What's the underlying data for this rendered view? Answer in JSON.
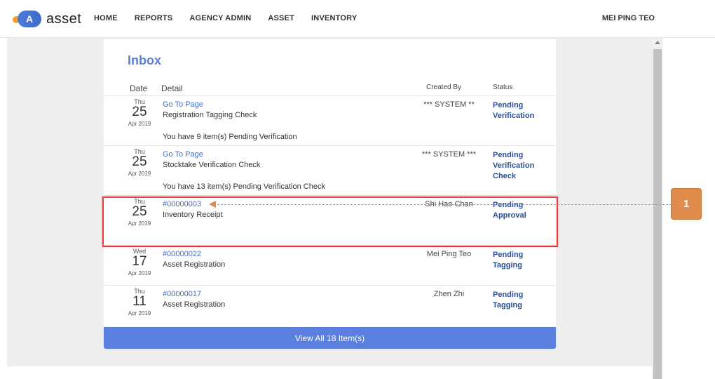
{
  "app": {
    "logo_letter": "A",
    "logo_text": "asset"
  },
  "nav": [
    {
      "label": "HOME"
    },
    {
      "label": "REPORTS"
    },
    {
      "label": "AGENCY ADMIN"
    },
    {
      "label": "ASSET"
    },
    {
      "label": "INVENTORY"
    }
  ],
  "user": {
    "name": "MEI PING TEO"
  },
  "inbox": {
    "title": "Inbox",
    "headers": {
      "date": "Date",
      "detail": "Detail",
      "created_by": "Created By",
      "status": "Status"
    },
    "rows": [
      {
        "day": "Thu",
        "date": "25",
        "month_year": "Apr 2019",
        "link": "Go To Page",
        "title": "Registration Tagging Check",
        "note": "You have 9 item(s) Pending Verification",
        "created_by": "*** SYSTEM **",
        "status": "Pending Verification"
      },
      {
        "day": "Thu",
        "date": "25",
        "month_year": "Apr 2019",
        "link": "Go To Page",
        "title": "Stocktake Verification Check",
        "note": "You have 13 item(s) Pending Verification Check",
        "created_by": "*** SYSTEM ***",
        "status": "Pending Verification Check"
      },
      {
        "day": "Thu",
        "date": "25",
        "month_year": "Apr 2019",
        "link": "#00000003",
        "title": "Inventory Receipt",
        "note": "",
        "created_by": "Shi Hao Chan",
        "status": "Pending Approval"
      },
      {
        "day": "Wed",
        "date": "17",
        "month_year": "Apr 2019",
        "link": "#00000022",
        "title": "Asset Registration",
        "note": "",
        "created_by": "Mei Ping Teo",
        "status": "Pending Tagging"
      },
      {
        "day": "Thu",
        "date": "11",
        "month_year": "Apr 2019",
        "link": "#00000017",
        "title": "Asset Registration",
        "note": "",
        "created_by": "Zhen Zhi",
        "status": "Pending Tagging"
      }
    ],
    "view_all_label": "View All 18 Item(s)"
  },
  "callout": {
    "number": "1",
    "color": "#e08c4c"
  },
  "colors": {
    "accent": "#5a7fde",
    "link": "#3c6fd1",
    "status": "#2a4f95",
    "highlight": "#e04040"
  }
}
